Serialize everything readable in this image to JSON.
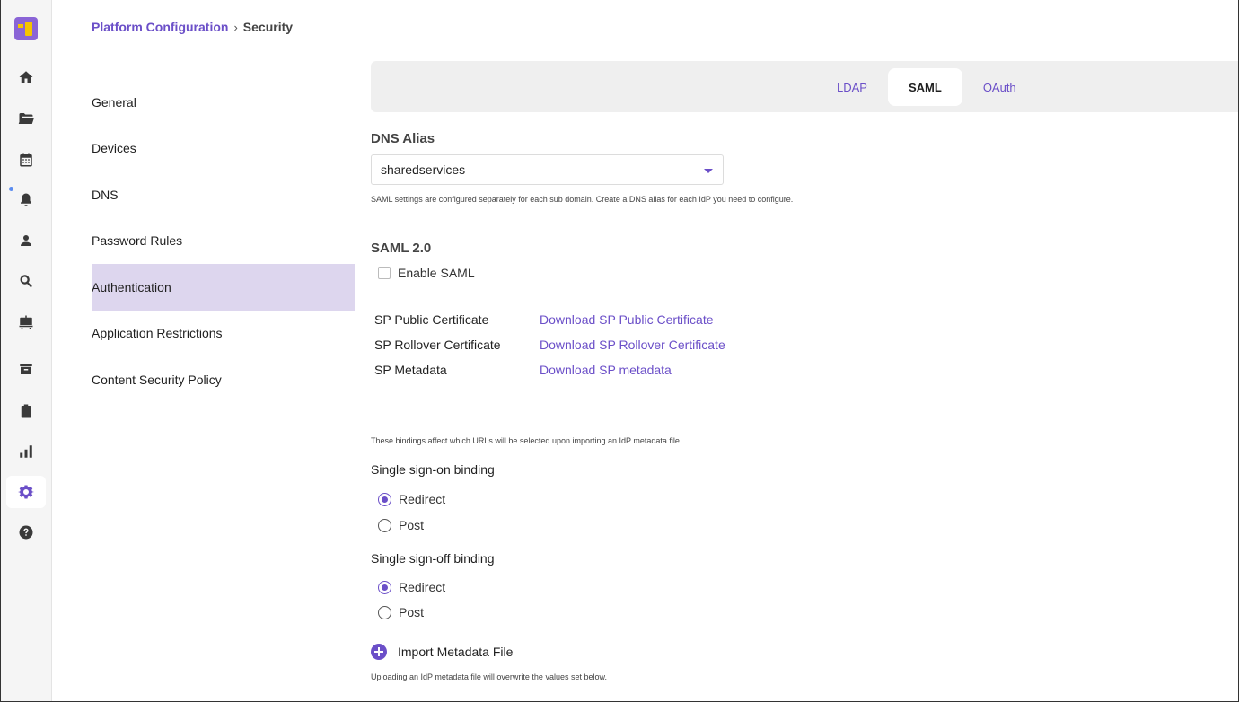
{
  "breadcrumb": {
    "parent": "Platform Configuration",
    "separator": "›",
    "current": "Security"
  },
  "rail": {
    "icons": [
      "home-icon",
      "folder-icon",
      "calendar-icon",
      "bell-icon",
      "user-icon",
      "search-icon",
      "briefcase-icon",
      "archive-icon",
      "clipboard-icon",
      "bar-chart-icon",
      "gear-icon",
      "help-icon"
    ],
    "active": "gear-icon"
  },
  "subnav": {
    "items": [
      {
        "label": "General"
      },
      {
        "label": "Devices"
      },
      {
        "label": "DNS"
      },
      {
        "label": "Password Rules"
      },
      {
        "label": "Authentication",
        "active": true
      },
      {
        "label": "Application Restrictions"
      },
      {
        "label": "Content Security Policy"
      }
    ]
  },
  "tabs": {
    "items": [
      {
        "label": "LDAP"
      },
      {
        "label": "SAML",
        "active": true
      },
      {
        "label": "OAuth"
      }
    ]
  },
  "dns_alias": {
    "title": "DNS Alias",
    "selected": "sharedservices",
    "hint": "SAML settings are configured separately for each sub domain. Create a DNS alias for each IdP you need to configure."
  },
  "saml": {
    "title": "SAML 2.0",
    "enable_label": "Enable SAML",
    "enabled": false,
    "certificates": [
      {
        "label": "SP Public Certificate",
        "link": "Download SP Public Certificate"
      },
      {
        "label": "SP Rollover Certificate",
        "link": "Download SP Rollover Certificate"
      },
      {
        "label": "SP Metadata",
        "link": "Download SP metadata"
      }
    ]
  },
  "bindings": {
    "hint": "These bindings affect which URLs will be selected upon importing an IdP metadata file.",
    "sign_on": {
      "label": "Single sign-on binding",
      "options": [
        "Redirect",
        "Post"
      ],
      "selected": "Redirect"
    },
    "sign_off": {
      "label": "Single sign-off binding",
      "options": [
        "Redirect",
        "Post"
      ],
      "selected": "Redirect"
    }
  },
  "import": {
    "label": "Import Metadata File",
    "hint": "Uploading an IdP metadata file will overwrite the values set below."
  },
  "colors": {
    "accent": "#6b4fc8",
    "active_nav_bg": "#ddd6ee"
  }
}
